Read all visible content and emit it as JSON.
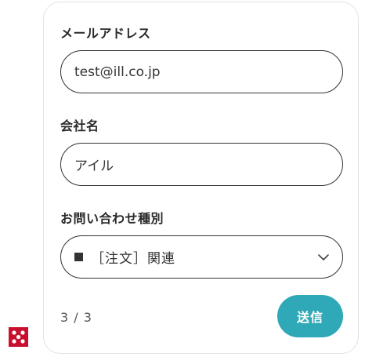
{
  "form": {
    "email_label": "メールアドレス",
    "email_value": "test@ill.co.jp",
    "company_label": "会社名",
    "company_value": "アイル",
    "inquiry_type_label": "お問い合わせ種別",
    "inquiry_type_value": "［注文］関連",
    "progress": "3 / 3",
    "submit_label": "送信"
  },
  "colors": {
    "accent": "#2fa8b7",
    "logo": "#c8102e"
  },
  "icons": {
    "select": "chevron-down-icon",
    "bullet": "square-icon",
    "brand": "brand-logo"
  }
}
